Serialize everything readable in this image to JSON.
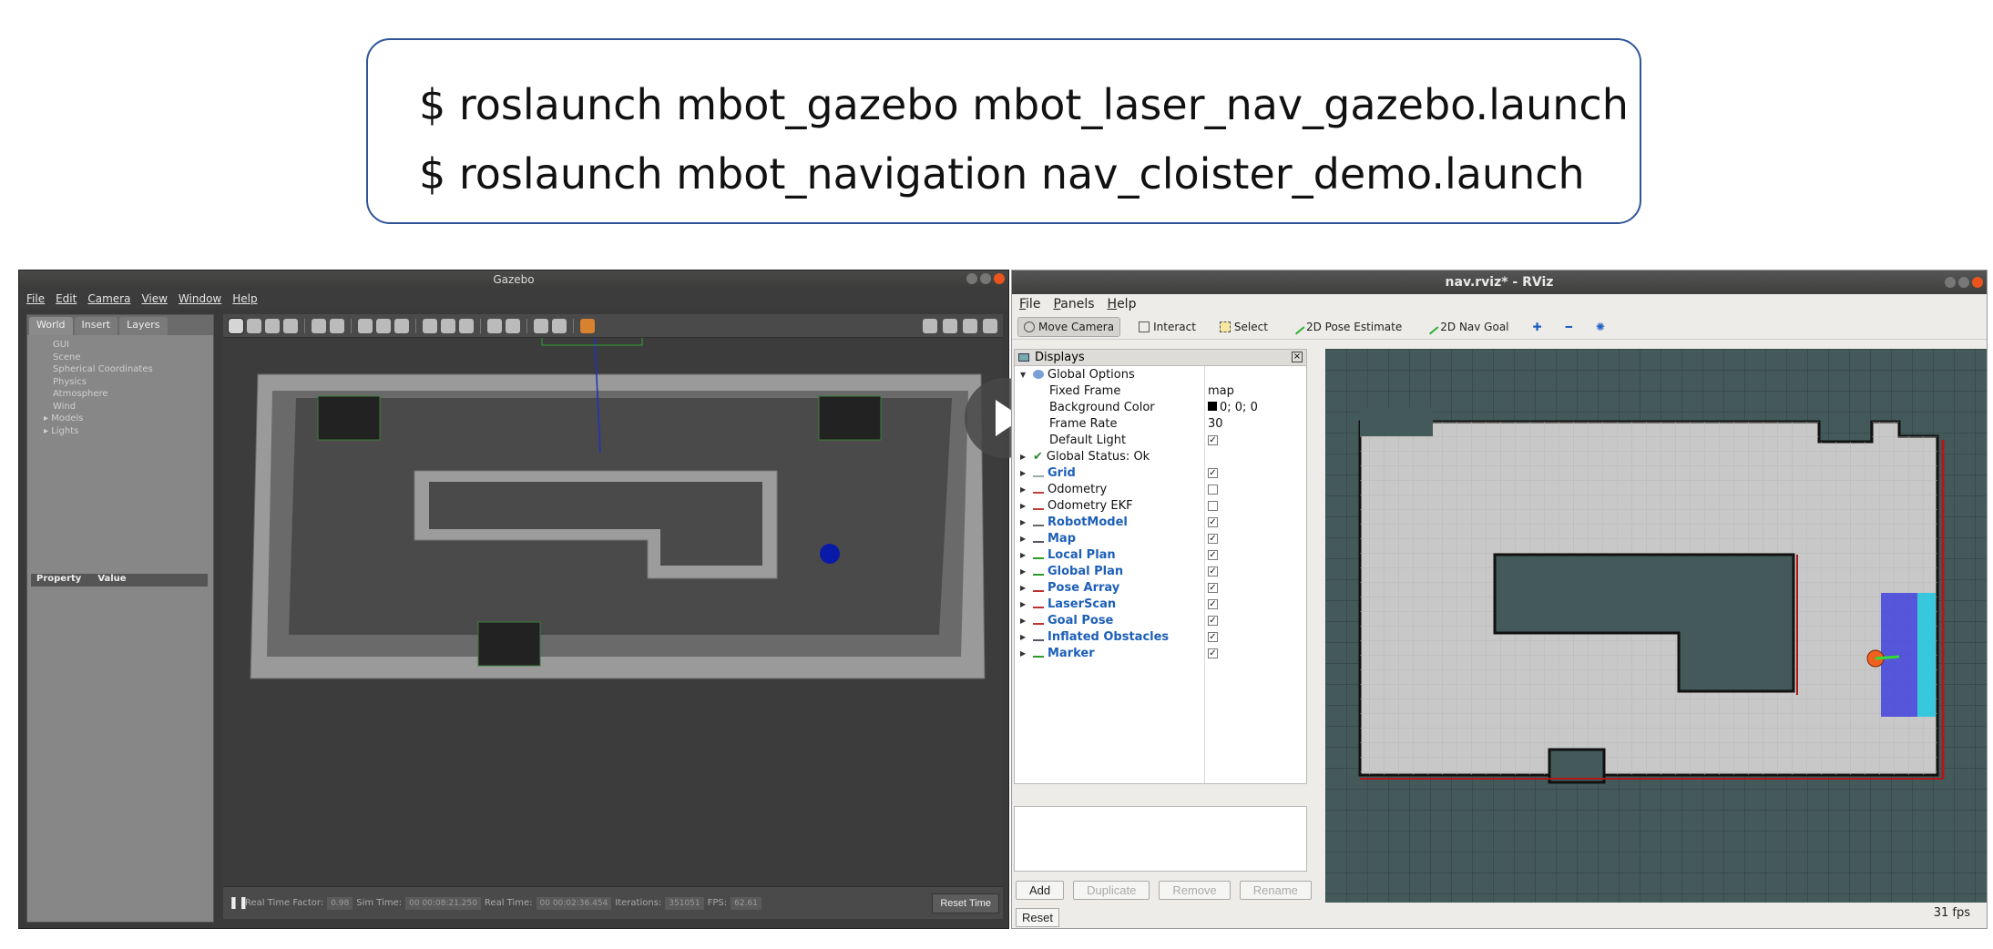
{
  "commands": {
    "line1": "$ roslaunch mbot_gazebo mbot_laser_nav_gazebo.launch",
    "line2": "$ roslaunch mbot_navigation nav_cloister_demo.launch"
  },
  "gazebo": {
    "title": "Gazebo",
    "menu": [
      "File",
      "Edit",
      "Camera",
      "View",
      "Window",
      "Help"
    ],
    "tabs": [
      "World",
      "Insert",
      "Layers"
    ],
    "tree": [
      "GUI",
      "Scene",
      "Spherical Coordinates",
      "Physics",
      "Atmosphere",
      "Wind",
      "Models",
      "Lights"
    ],
    "property_header": {
      "property": "Property",
      "value": "Value"
    },
    "status": {
      "real_time_factor_label": "Real Time Factor:",
      "real_time_factor": "0.98",
      "sim_time_label": "Sim Time:",
      "sim_time": "00 00:08:21.250",
      "real_time_label": "Real Time:",
      "real_time": "00 00:02:36.454",
      "iterations_label": "Iterations:",
      "iterations": "351051",
      "fps_label": "FPS:",
      "fps": "62.61",
      "reset_label": "Reset Time"
    },
    "colors": {
      "robot": "#0a1aa8",
      "wall": "#9a9a9a",
      "floor": "#4a4a4a"
    }
  },
  "rviz": {
    "title": "nav.rviz* - RViz",
    "menu": [
      "File",
      "Panels",
      "Help"
    ],
    "tools": [
      "Move Camera",
      "Interact",
      "Select",
      "2D Pose Estimate",
      "2D Nav Goal"
    ],
    "displays_title": "Displays",
    "global_options": {
      "label": "Global Options",
      "fixed_frame_label": "Fixed Frame",
      "fixed_frame": "map",
      "background_color_label": "Background Color",
      "background_color": "0; 0; 0",
      "frame_rate_label": "Frame Rate",
      "frame_rate": "30",
      "default_light_label": "Default Light"
    },
    "global_status": "Global Status: Ok",
    "displays": [
      {
        "name": "Grid",
        "checked": true,
        "highlight": true
      },
      {
        "name": "Odometry",
        "checked": false,
        "highlight": false
      },
      {
        "name": "Odometry EKF",
        "checked": false,
        "highlight": false
      },
      {
        "name": "RobotModel",
        "checked": true,
        "highlight": true
      },
      {
        "name": "Map",
        "checked": true,
        "highlight": true
      },
      {
        "name": "Local Plan",
        "checked": true,
        "highlight": true
      },
      {
        "name": "Global Plan",
        "checked": true,
        "highlight": true
      },
      {
        "name": "Pose Array",
        "checked": true,
        "highlight": true
      },
      {
        "name": "LaserScan",
        "checked": true,
        "highlight": true
      },
      {
        "name": "Goal Pose",
        "checked": true,
        "highlight": true
      },
      {
        "name": "Inflated Obstacles",
        "checked": true,
        "highlight": true
      },
      {
        "name": "Marker",
        "checked": true,
        "highlight": true
      }
    ],
    "buttons": [
      "Add",
      "Duplicate",
      "Remove",
      "Rename"
    ],
    "reset_label": "Reset",
    "fps": "31 fps",
    "colors": {
      "map_bg": "#445a5a",
      "free": "#c8c8c8",
      "highlight": "#1d5fb8"
    }
  }
}
